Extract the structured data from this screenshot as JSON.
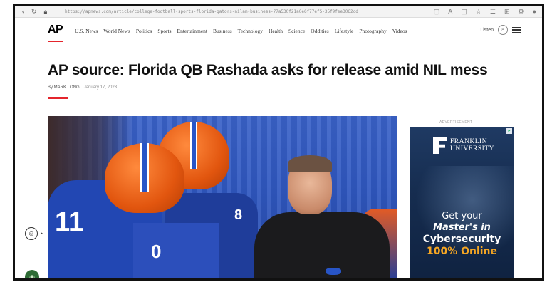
{
  "browser": {
    "url": "https://apnews.com/article/college-football-sports-florida-gators-nilam-business-77a530f21a0e6f77ef5-35f9fee3062cd",
    "back_icon": "chevron-left-icon",
    "reload_icon": "reload-icon"
  },
  "site": {
    "logo": "AP",
    "nav": [
      "U.S. News",
      "World News",
      "Politics",
      "Sports",
      "Entertainment",
      "Business",
      "Technology",
      "Health",
      "Science",
      "Oddities",
      "Lifestyle",
      "Photography",
      "Videos"
    ],
    "listen": "Listen"
  },
  "article": {
    "headline": "AP source: Florida QB Rashada asks for release amid NIL mess",
    "author": "By MARK LONG",
    "date": "January 17, 2023"
  },
  "photo": {
    "numbers": [
      "8",
      "11",
      "0"
    ]
  },
  "ad": {
    "label": "ADVERTISEMENT",
    "brand_line1": "FRANKLIN",
    "brand_line2": "UNIVERSITY",
    "line1": "Get your",
    "line2": "Master's in",
    "line3": "Cybersecurity",
    "line4": "100% Online",
    "accent": "#f5a623"
  },
  "colors": {
    "brand_red": "#e4252c"
  }
}
